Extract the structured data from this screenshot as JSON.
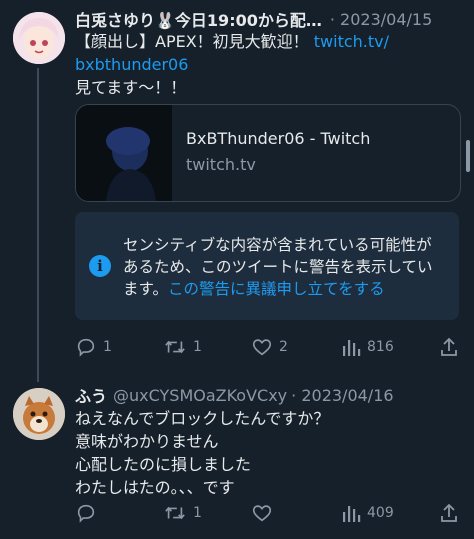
{
  "tweet1": {
    "name": "白兎さゆり🐰今日19:00から配…",
    "date": "· 2023/04/15",
    "text_line1": "【顔出し】APEX！初見大歓迎！",
    "link_part1": "twitch.tv/",
    "link_part2": "bxbthunder06",
    "text_line3": "見てます〜！！",
    "card": {
      "title": "BxBThunder06 - Twitch",
      "domain": "twitch.tv"
    },
    "warning": {
      "line1": "センシティブな内容が含まれている可能性が",
      "line2": "あるため、このツイートに警告を表示してい",
      "line3_text": "ます。",
      "line3_link": "この警告に異議申し立てをする"
    },
    "actions": {
      "replies": "1",
      "retweets": "1",
      "likes": "2",
      "views": "816"
    }
  },
  "tweet2": {
    "name": "ふう",
    "handle": "@uxCYSMOaZKoVCxy",
    "date": "· 2023/04/16",
    "lines": [
      "ねえなんでブロックしたんですか？",
      "意味がわかりません",
      "心配したのに損しました",
      "わたしはたの。、、です"
    ],
    "actions": {
      "replies": "",
      "retweets": "1",
      "likes": "",
      "views": "409"
    }
  },
  "icons": [
    "reply-icon",
    "retweet-icon",
    "like-icon",
    "views-icon",
    "share-icon",
    "info-icon"
  ],
  "colors": {
    "background": "#15202b",
    "accent": "#1d9bf0",
    "muted": "#8b98a5",
    "warning_bg": "#1e2d3d"
  }
}
